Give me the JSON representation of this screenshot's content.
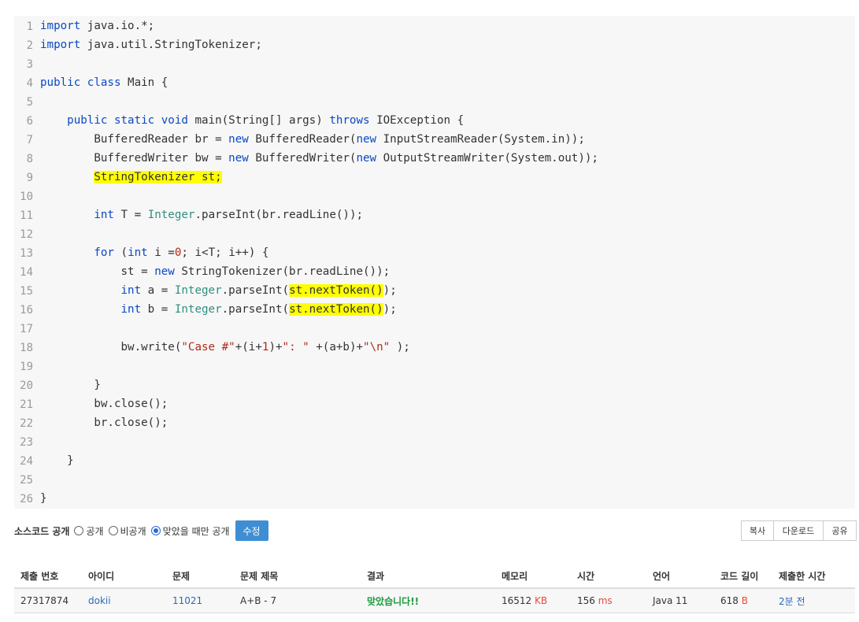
{
  "code_lines": [
    "import java.io.*;",
    "import java.util.StringTokenizer;",
    "",
    "public class Main {",
    "",
    "    public static void main(String[] args) throws IOException {",
    "        BufferedReader br = new BufferedReader(new InputStreamReader(System.in));",
    "        BufferedWriter bw = new BufferedWriter(new OutputStreamWriter(System.out));",
    "        StringTokenizer st;",
    "",
    "        int T = Integer.parseInt(br.readLine());",
    "",
    "        for (int i =0; i<T; i++) {",
    "            st = new StringTokenizer(br.readLine());",
    "            int a = Integer.parseInt(st.nextToken());",
    "            int b = Integer.parseInt(st.nextToken());",
    "",
    "            bw.write(\"Case #\"+(i+1)+\": \" +(a+b)+\"\\n\" );",
    "",
    "        }",
    "        bw.close();",
    "        br.close();",
    "",
    "    }",
    "",
    "}"
  ],
  "source_options": {
    "label": "소스코드 공개",
    "options": [
      "공개",
      "비공개",
      "맞았을 때만 공개"
    ],
    "selected": "맞았을 때만 공개",
    "edit_button": "수정"
  },
  "actions": [
    "복사",
    "다운로드",
    "공유"
  ],
  "table": {
    "headers": [
      "제출 번호",
      "아이디",
      "문제",
      "문제 제목",
      "결과",
      "메모리",
      "시간",
      "언어",
      "코드 길이",
      "제출한 시간"
    ],
    "row": {
      "submission_id": "27317874",
      "user": "dokii",
      "problem": "11021",
      "title": "A+B - 7",
      "result": "맞았습니다!!",
      "memory": "16512",
      "memory_unit": "KB",
      "time": "156",
      "time_unit": "ms",
      "language": "Java 11",
      "code_length": "618",
      "code_length_unit": "B",
      "submitted": "2분 전"
    }
  },
  "colors": {
    "keyword": "#0a48c4",
    "string": "#b02a1a",
    "type": "#2f8f7f",
    "highlight": "#ffff00",
    "accept": "#1a9a3a",
    "link": "#2a6ab8",
    "button": "#3f8ed4"
  }
}
